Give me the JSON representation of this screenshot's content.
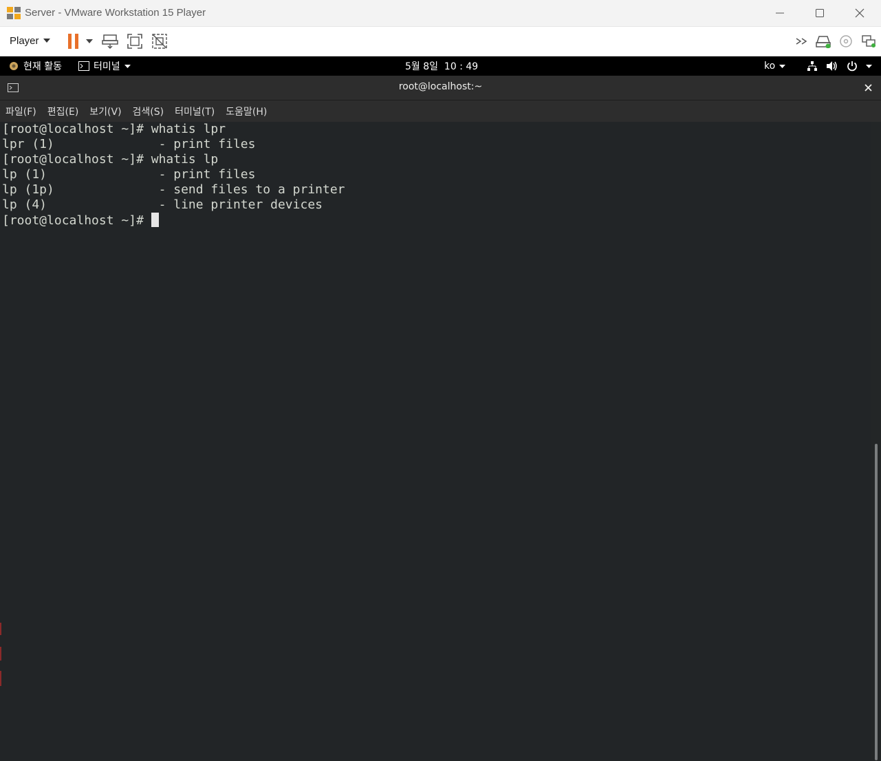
{
  "window": {
    "title": "Server - VMware Workstation 15 Player",
    "controls": [
      "minimize",
      "maximize",
      "close"
    ]
  },
  "vm_toolbar": {
    "player_label": "Player",
    "icons": [
      "pause-icon",
      "dropdown-arrow-icon",
      "send-ctrl-alt-del-icon",
      "fullscreen-icon",
      "unity-icon",
      "more-icon",
      "hard-disk-icon",
      "cd-icon",
      "network-adapter-icon"
    ],
    "accent": "#e8702a"
  },
  "gnome_bar": {
    "activities": "현재 활동",
    "app_menu": "터미널",
    "clock": "5월 8일  10 : 49",
    "input_method": "ko"
  },
  "terminal": {
    "title": "root@localhost:~",
    "menu": [
      "파일(F)",
      "편집(E)",
      "보기(V)",
      "검색(S)",
      "터미널(T)",
      "도움말(H)"
    ],
    "lines": [
      "[root@localhost ~]# whatis lpr",
      "lpr (1)              - print files",
      "[root@localhost ~]# whatis lp",
      "lp (1)               - print files",
      "lp (1p)              - send files to a printer",
      "lp (4)               - line printer devices"
    ],
    "prompt": "[root@localhost ~]# ",
    "background": "#222527",
    "foreground": "#d3d7cf"
  }
}
